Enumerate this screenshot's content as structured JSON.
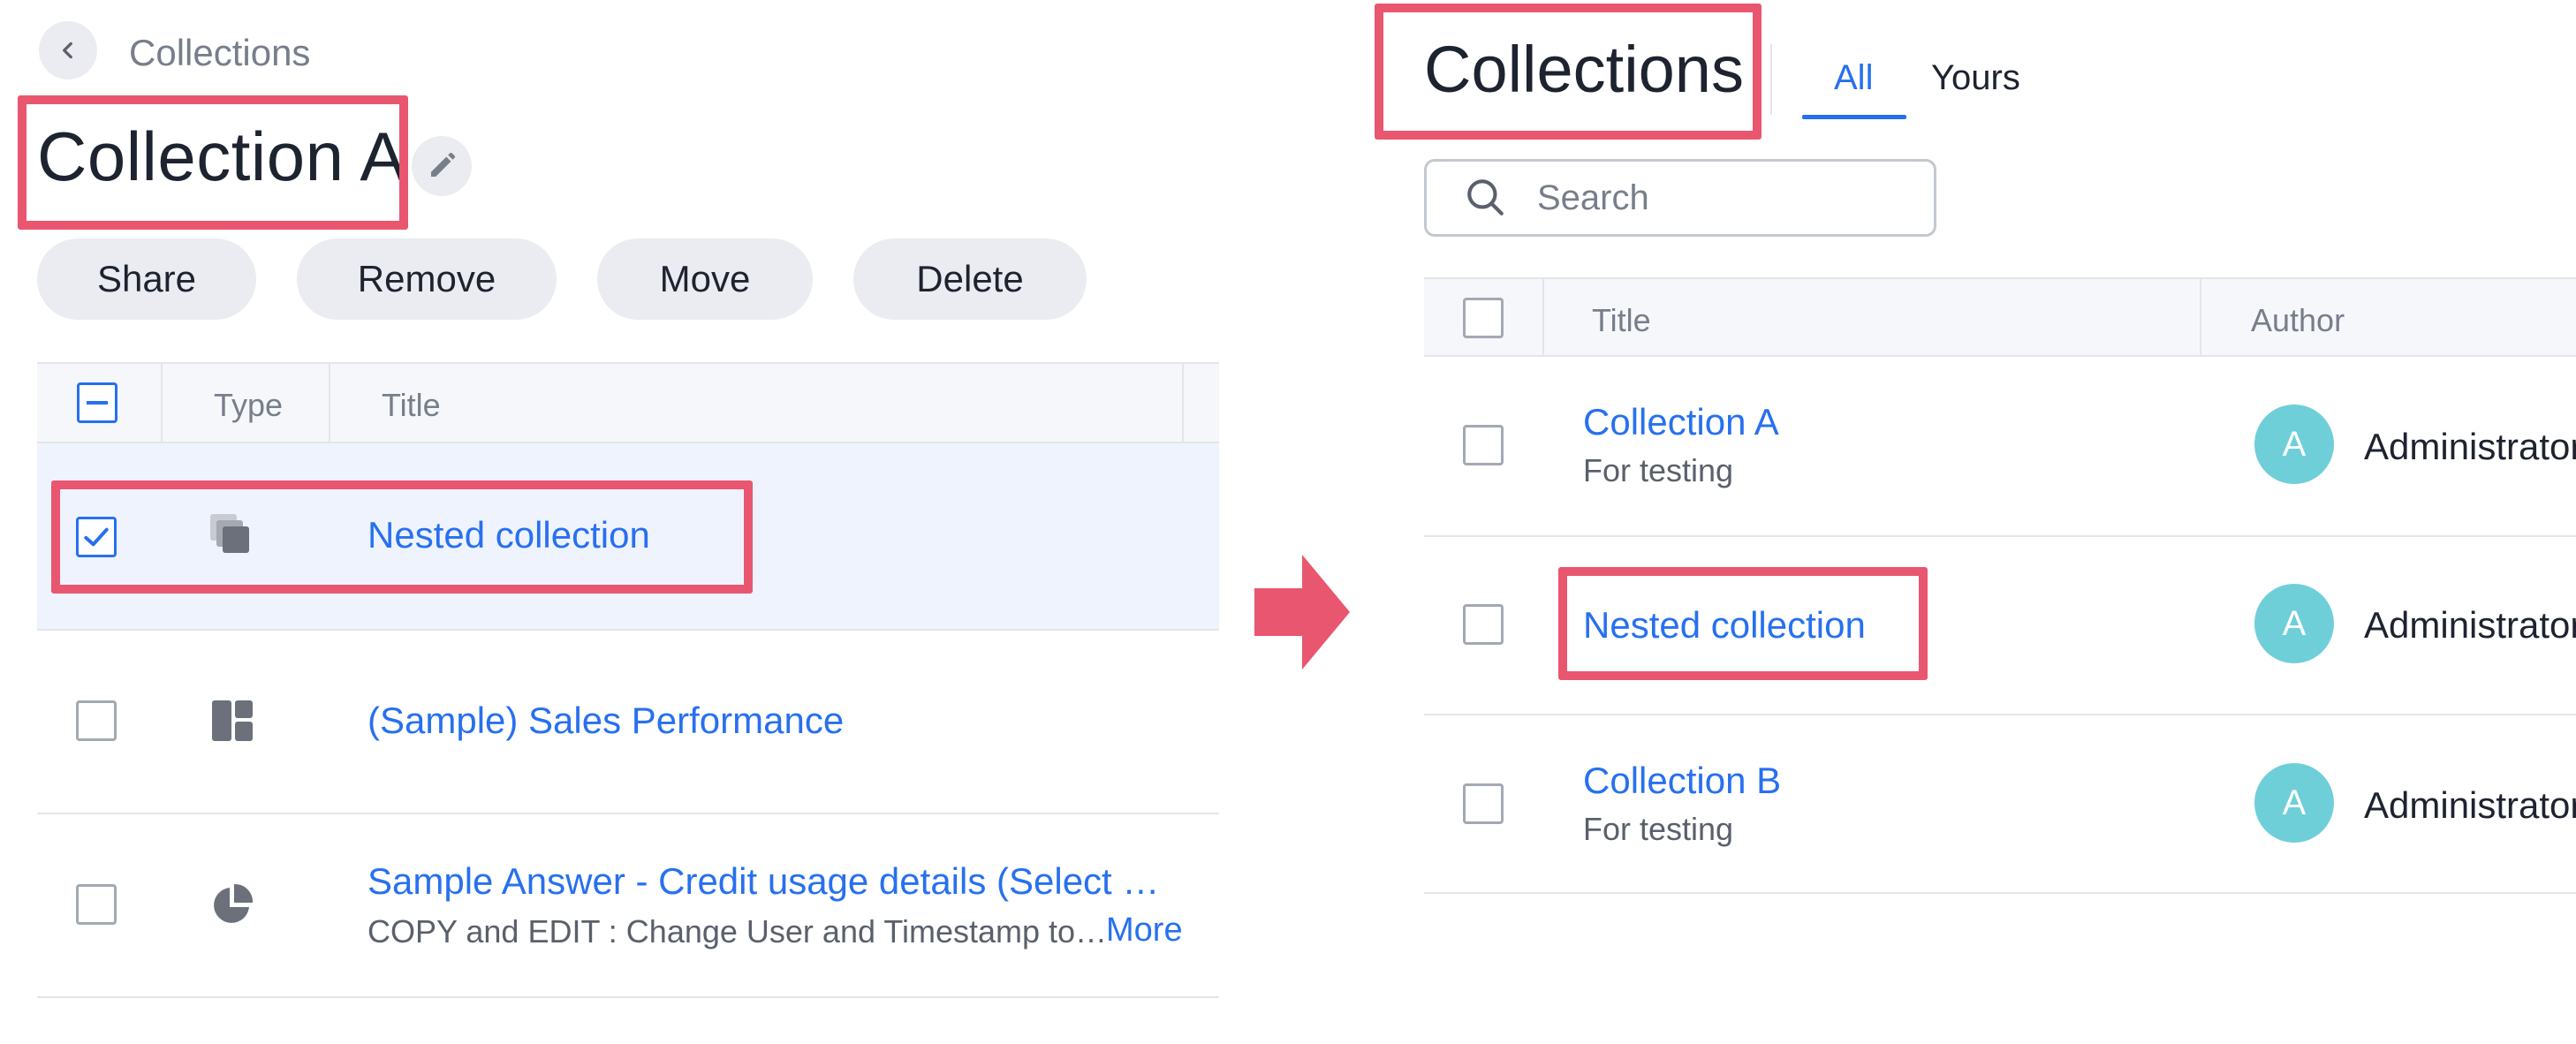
{
  "left": {
    "breadcrumb": "Collections",
    "title": "Collection A",
    "actions": {
      "share": "Share",
      "remove": "Remove",
      "move": "Move",
      "delete": "Delete"
    },
    "columns": {
      "type": "Type",
      "title": "Title"
    },
    "rows": [
      {
        "title": "Nested collection",
        "subtitle": "",
        "icon": "collection-icon",
        "selected": true
      },
      {
        "title": "(Sample) Sales Performance",
        "subtitle": "",
        "icon": "liveboard-icon",
        "selected": false
      },
      {
        "title": "Sample Answer - Credit usage details (Select …",
        "subtitle": "COPY and EDIT : Change User and Timestamp to…",
        "more": "More",
        "icon": "pie-chart-icon",
        "selected": false
      }
    ]
  },
  "right": {
    "title": "Collections",
    "tabs": {
      "all": "All",
      "yours": "Yours",
      "active": "All"
    },
    "search_placeholder": "Search",
    "columns": {
      "title": "Title",
      "author": "Author"
    },
    "rows": [
      {
        "title": "Collection A",
        "subtitle": "For testing",
        "avatar": "A",
        "author": "Administrator"
      },
      {
        "title": "Nested collection",
        "subtitle": "",
        "avatar": "A",
        "author": "Administrator"
      },
      {
        "title": "Collection B",
        "subtitle": "For testing",
        "avatar": "A",
        "author": "Administrator"
      }
    ]
  },
  "colors": {
    "accent_blue": "#2770ef",
    "highlight_pink": "#e9566f",
    "avatar_teal": "#6ecfd9",
    "selected_row_bg": "#eef3fe"
  }
}
